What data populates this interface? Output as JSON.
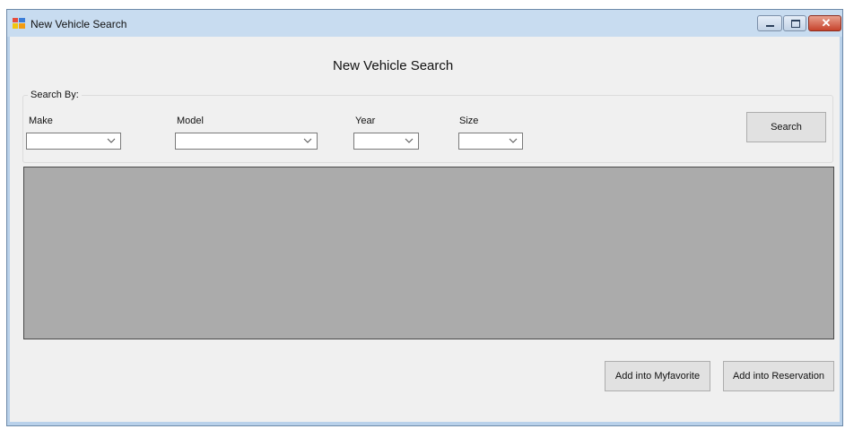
{
  "window": {
    "title": "New Vehicle Search",
    "close_glyph": "✕"
  },
  "form": {
    "heading": "New Vehicle Search",
    "group_label": "Search By:",
    "fields": {
      "make_label": "Make",
      "model_label": "Model",
      "year_label": "Year",
      "size_label": "Size",
      "make_value": "",
      "model_value": "",
      "year_value": "",
      "size_value": ""
    },
    "search_button": "Search",
    "add_favorite_button": "Add into Myfavorite",
    "add_reservation_button": "Add into Reservation"
  },
  "icons": [
    "app-icon",
    "minimize-icon",
    "maximize-icon",
    "close-icon",
    "chevron-down-icon"
  ],
  "colors": {
    "grid_background": "#ababab",
    "close_button": "#c7432c",
    "form_background": "#f0f0f0"
  }
}
